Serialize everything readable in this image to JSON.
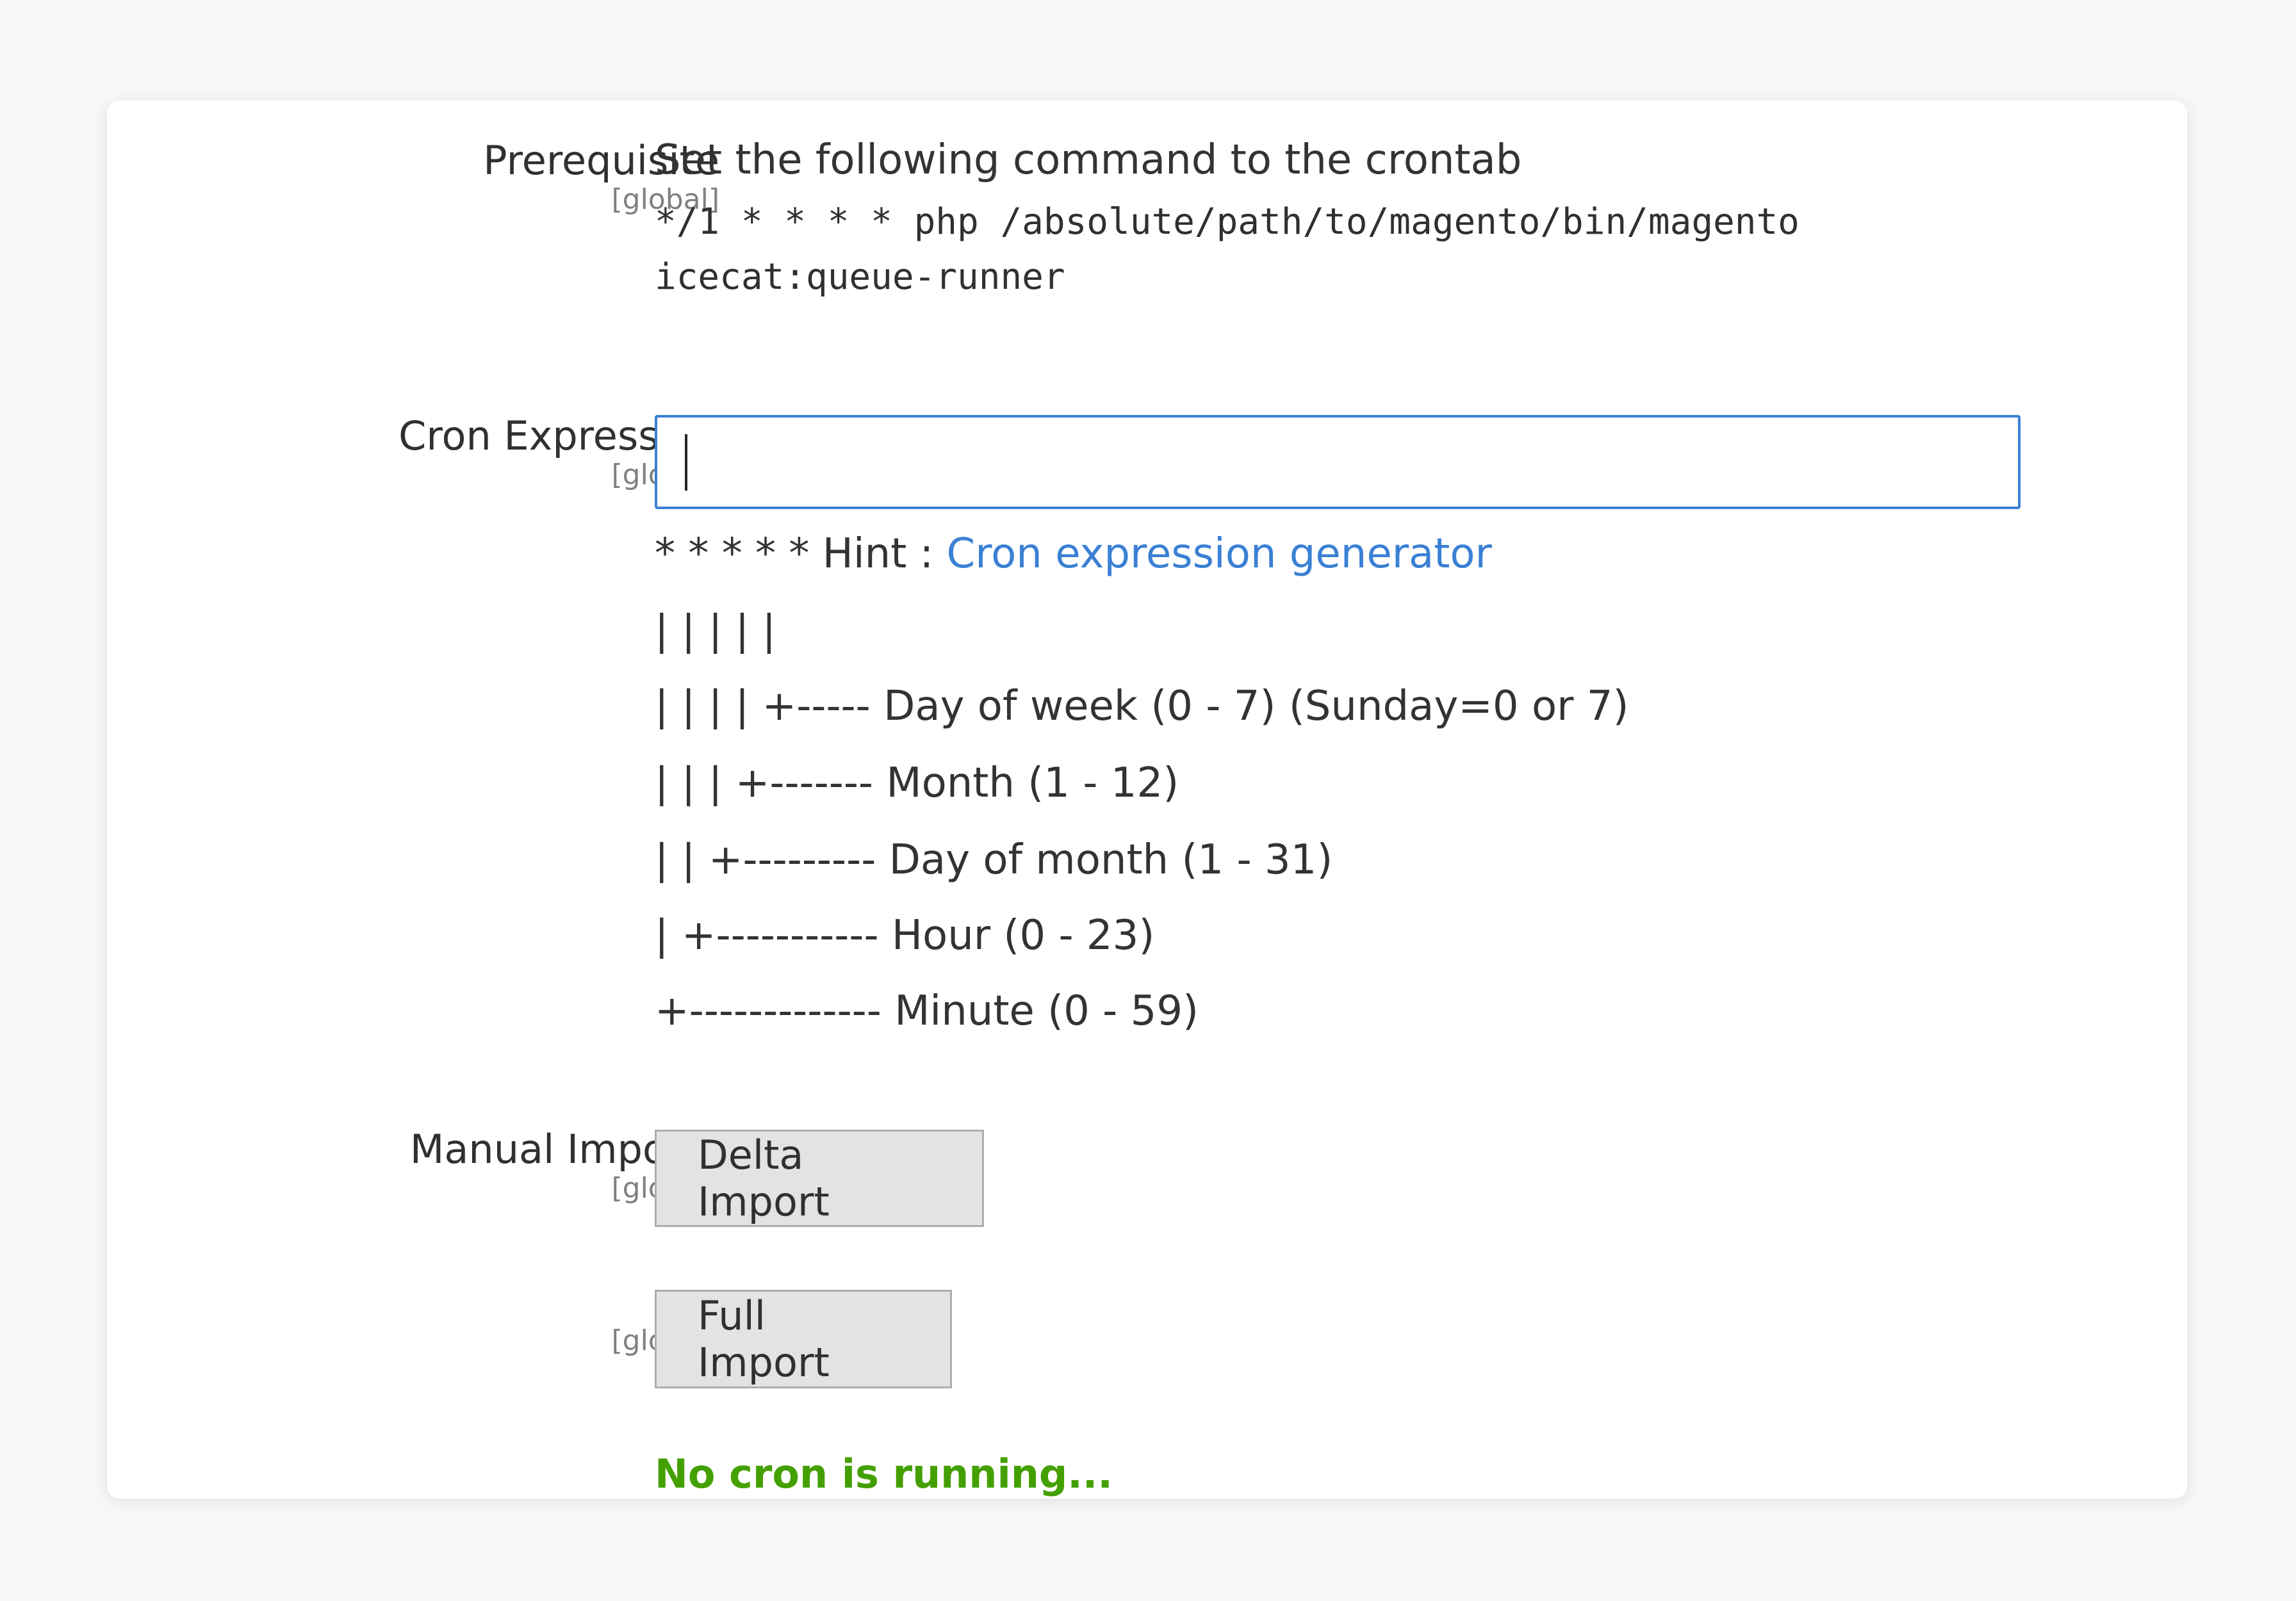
{
  "prerequisite": {
    "title": "Prerequisite",
    "scope": "[global]",
    "comment": "Set the following command to the crontab",
    "command_line1": "*/1 * * * * php /absolute/path/to/magento/bin/magento",
    "command_line2": "icecat:queue-runner"
  },
  "cron_expression": {
    "title": "Cron Expression",
    "scope": "[global]",
    "value": "",
    "hint_prefix": "* * * * * Hint : ",
    "hint_link": "Cron expression generator",
    "lines": [
      "| | | | |",
      "| | | | +----- Day of week (0 - 7) (Sunday=0 or 7)",
      "| | | +------- Month (1 - 12)",
      "| | +--------- Day of month (1 - 31)",
      "| +----------- Hour (0 - 23)",
      "+------------- Minute (0 - 59)"
    ]
  },
  "manual_imports": {
    "title": "Manual Imports",
    "scope": "[global]",
    "delta_button": "Delta Import",
    "full_scope": "[global]",
    "full_button": "Full Import",
    "status": "No cron is running..."
  },
  "colors": {
    "accent": "#3a80d4",
    "status_green": "#44a000",
    "button_bg": "#e3e3e3"
  }
}
